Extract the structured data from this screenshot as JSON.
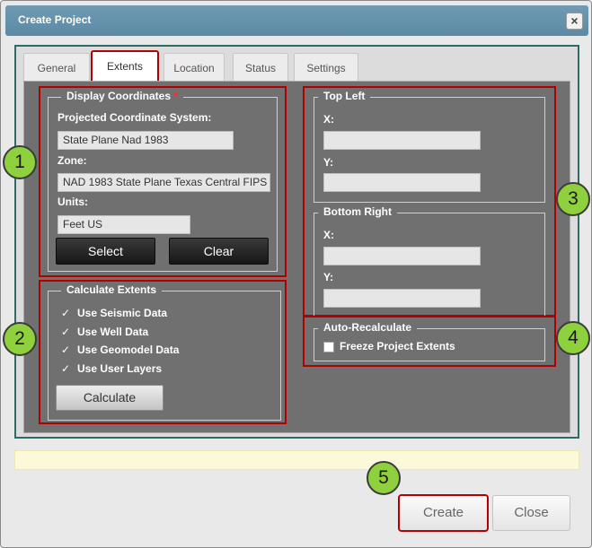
{
  "window": {
    "title": "Create Project",
    "close_glyph": "×"
  },
  "tabs": [
    {
      "label": "General"
    },
    {
      "label": "Extents"
    },
    {
      "label": "Location"
    },
    {
      "label": "Status"
    },
    {
      "label": "Settings"
    }
  ],
  "display_coordinates": {
    "legend": "Display Coordinates",
    "required_mark": "*",
    "projected_label": "Projected Coordinate System:",
    "projected_value": "State Plane Nad 1983",
    "zone_label": "Zone:",
    "zone_value": "NAD 1983 State Plane Texas Central FIPS",
    "units_label": "Units:",
    "units_value": "Feet US",
    "select_button": "Select",
    "clear_button": "Clear"
  },
  "calculate_extents": {
    "legend": "Calculate Extents",
    "check_glyph": "✓",
    "options": [
      {
        "label": "Use Seismic Data",
        "checked": true
      },
      {
        "label": "Use Well Data",
        "checked": true
      },
      {
        "label": "Use Geomodel Data",
        "checked": true
      },
      {
        "label": "Use User Layers",
        "checked": true
      }
    ],
    "calculate_button": "Calculate"
  },
  "top_left": {
    "legend": "Top Left",
    "x_label": "X:",
    "x_value": "",
    "y_label": "Y:",
    "y_value": ""
  },
  "bottom_right": {
    "legend": "Bottom Right",
    "x_label": "X:",
    "x_value": "",
    "y_label": "Y:",
    "y_value": ""
  },
  "auto_recalculate": {
    "legend": "Auto-Recalculate",
    "freeze_label": "Freeze Project Extents",
    "freeze_checked": false
  },
  "status_message": "",
  "footer": {
    "create_button": "Create",
    "close_button": "Close"
  },
  "callouts": [
    "1",
    "2",
    "3",
    "4",
    "5"
  ],
  "colors": {
    "title_bar": "#5b8aa5",
    "content_bg": "#707070",
    "highlight_red": "#b00000",
    "frame_teal": "#2f6b66",
    "callout_green": "#8fd13d",
    "status_bar": "#fbf9d9"
  }
}
